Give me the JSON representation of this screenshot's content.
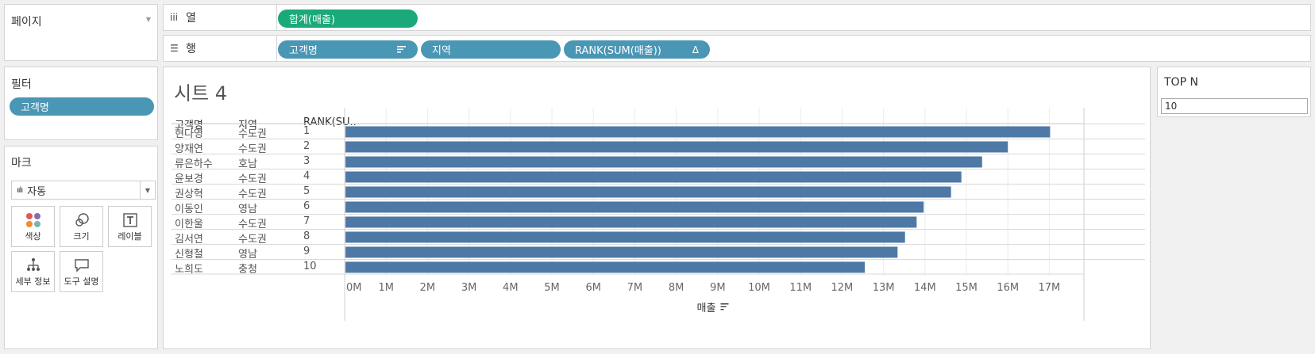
{
  "pages": {
    "title": "페이지"
  },
  "columns_shelf": {
    "label": "열",
    "icon": "iii",
    "pills": [
      {
        "label": "합계(매출)",
        "color": "#1aa97a"
      }
    ]
  },
  "rows_shelf": {
    "label": "행",
    "icon": "☰",
    "pills": [
      {
        "label": "고객명",
        "icon": "sort-desc-icon"
      },
      {
        "label": "지역"
      },
      {
        "label": "RANK(SUM(매출))",
        "icon": "delta-icon"
      }
    ]
  },
  "filters": {
    "title": "필터",
    "pills": [
      {
        "label": "고객명"
      }
    ]
  },
  "marks": {
    "title": "마크",
    "type": "자동",
    "buttons": [
      {
        "label": "색상",
        "icon": "color-dots-icon"
      },
      {
        "label": "크기",
        "icon": "size-circles-icon"
      },
      {
        "label": "레이블",
        "icon": "text-label-icon"
      },
      {
        "label": "세부 정보",
        "icon": "detail-tree-icon"
      },
      {
        "label": "도구 설명",
        "icon": "tooltip-icon"
      }
    ]
  },
  "sheet": {
    "title": "시트 4",
    "headers": {
      "name": "고객명",
      "region": "지역",
      "rank": "RANK(SU.."
    }
  },
  "chart_data": {
    "type": "bar",
    "orientation": "horizontal",
    "bar_color": "#4e79a7",
    "rows": [
      {
        "name": "현다영",
        "region": "수도권",
        "rank": "1",
        "value": 17.0
      },
      {
        "name": "양재연",
        "region": "수도권",
        "rank": "2",
        "value": 15.98
      },
      {
        "name": "류은하수",
        "region": "호남",
        "rank": "3",
        "value": 15.36
      },
      {
        "name": "윤보경",
        "region": "수도권",
        "rank": "4",
        "value": 14.86
      },
      {
        "name": "권상혁",
        "region": "수도권",
        "rank": "5",
        "value": 14.61
      },
      {
        "name": "이동인",
        "region": "영남",
        "rank": "6",
        "value": 13.95
      },
      {
        "name": "이한울",
        "region": "수도권",
        "rank": "7",
        "value": 13.78
      },
      {
        "name": "김서연",
        "region": "수도권",
        "rank": "8",
        "value": 13.5
      },
      {
        "name": "신형철",
        "region": "영남",
        "rank": "9",
        "value": 13.32
      },
      {
        "name": "노희도",
        "region": "충청",
        "rank": "10",
        "value": 12.53
      }
    ],
    "x_ticks": [
      "0M",
      "1M",
      "2M",
      "3M",
      "4M",
      "5M",
      "6M",
      "7M",
      "8M",
      "9M",
      "10M",
      "11M",
      "12M",
      "13M",
      "14M",
      "15M",
      "16M",
      "17M"
    ],
    "xlim": [
      0,
      17.8
    ],
    "xlabel": "매출",
    "unit": "M",
    "grid": true
  },
  "topn": {
    "title": "TOP N",
    "value": "10"
  }
}
